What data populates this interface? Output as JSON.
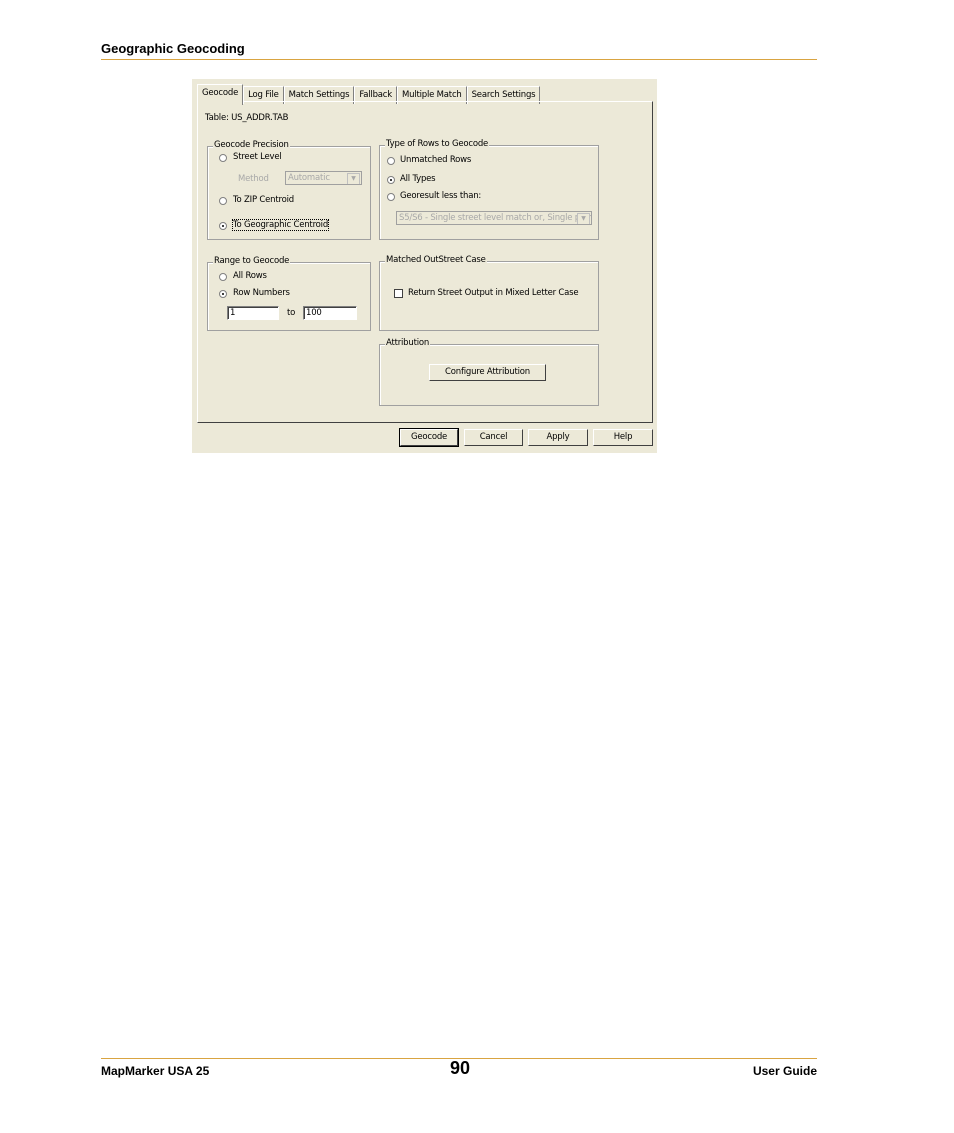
{
  "page": {
    "header": "Geographic Geocoding",
    "footer_left": "MapMarker USA 25",
    "page_number": "90",
    "footer_right": "User Guide",
    "accent_color": "#d9a441"
  },
  "dialog": {
    "tabs": [
      "Geocode",
      "Log File",
      "Match Settings",
      "Fallback",
      "Multiple Match",
      "Search Settings"
    ],
    "active_tab": "Geocode",
    "table_label": "Table:  US_ADDR.TAB",
    "precision": {
      "title": "Geocode Precision",
      "street_level": "Street Level",
      "method_label": "Method",
      "method_value": "Automatic",
      "zip_centroid": "To ZIP Centroid",
      "geographic_centroid": "To Geographic Centroid",
      "selected": "To Geographic Centroid"
    },
    "rows_type": {
      "title": "Type of Rows to Geocode",
      "unmatched": "Unmatched Rows",
      "all_types": "All Types",
      "georesult": "Georesult less than:",
      "georesult_value": "S5/S6 - Single street level match or, Single poin",
      "selected": "All Types"
    },
    "range": {
      "title": "Range to Geocode",
      "all_rows": "All Rows",
      "row_numbers": "Row Numbers",
      "from": "1",
      "to_label": "to",
      "to": "100",
      "selected": "Row Numbers"
    },
    "case": {
      "title": "Matched OutStreet Case",
      "checkbox_label": "Return Street Output in Mixed Letter Case",
      "checked": false
    },
    "attribution": {
      "title": "Attribution",
      "button": "Configure Attribution"
    },
    "buttons": {
      "geocode": "Geocode",
      "cancel": "Cancel",
      "apply": "Apply",
      "help": "Help"
    }
  }
}
